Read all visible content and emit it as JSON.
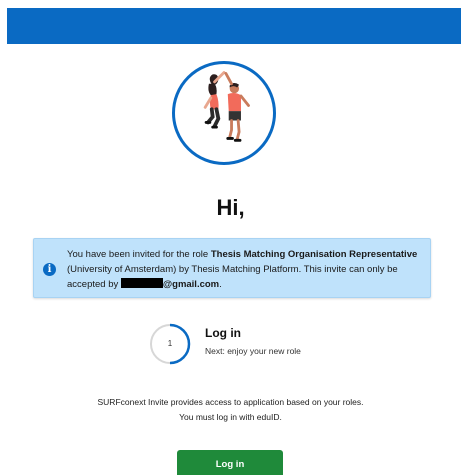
{
  "header": {
    "color": "#0a6ac3"
  },
  "hero": {
    "icon": "high-five-illustration"
  },
  "greeting": "Hi,",
  "invite": {
    "text_before_role": "You have been invited for the role ",
    "role": "Thesis Matching Organisation Representative",
    "text_after_role": " (University of Amsterdam) by Thesis Matching Platform. This invite can only be accepted by ",
    "email_domain": "@gmail.com",
    "text_end": ".",
    "icon": "info-icon",
    "background_color": "#bfe2fb"
  },
  "step": {
    "number": "1",
    "title": "Log in",
    "subtitle": "Next: enjoy your new role"
  },
  "info": {
    "line1": "SURFconext Invite provides access to application based on your roles.",
    "line2": "You must log in with eduID."
  },
  "login_button": {
    "label": "Log in",
    "color": "#1f8a3a"
  }
}
